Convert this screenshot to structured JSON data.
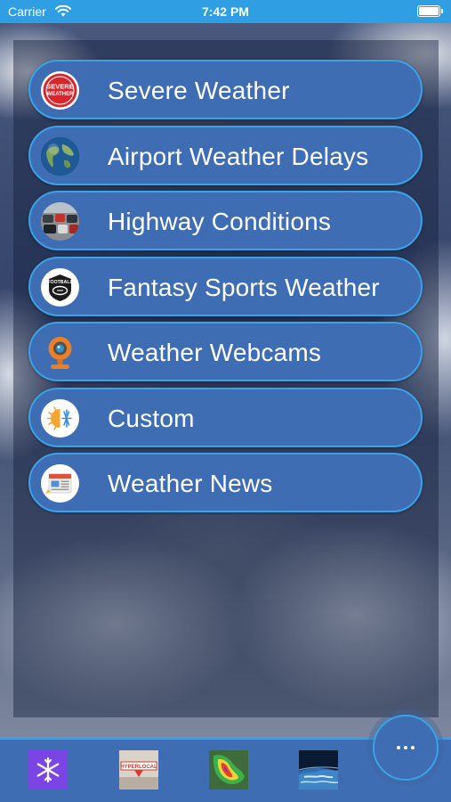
{
  "status_bar": {
    "carrier": "Carrier",
    "time": "7:42 PM",
    "wifi_icon": "wifi-icon",
    "battery_icon": "battery-icon"
  },
  "menu": {
    "items": [
      {
        "label": "Severe Weather",
        "icon": "severe-weather-icon"
      },
      {
        "label": "Airport Weather Delays",
        "icon": "globe-icon"
      },
      {
        "label": "Highway Conditions",
        "icon": "traffic-icon"
      },
      {
        "label": "Fantasy Sports Weather",
        "icon": "football-icon"
      },
      {
        "label": "Weather Webcams",
        "icon": "webcam-icon"
      },
      {
        "label": "Custom",
        "icon": "sun-snowflake-icon"
      },
      {
        "label": "Weather News",
        "icon": "newspaper-icon"
      }
    ],
    "severe_badge_text": "SEVERE WEATHER",
    "football_badge_text": "FOOTBALL"
  },
  "bottom_bar": {
    "tabs": [
      {
        "icon": "snowflake-icon"
      },
      {
        "icon": "hyperlocal-icon",
        "text": "HYPERLOCAL"
      },
      {
        "icon": "radar-icon"
      },
      {
        "icon": "earth-icon"
      }
    ],
    "more_icon": "more-dots-icon"
  },
  "colors": {
    "status_bar": "#2f9ee3",
    "button_fill": "#3f6db3",
    "button_border": "#3aa2e6",
    "text": "#ffffff"
  }
}
